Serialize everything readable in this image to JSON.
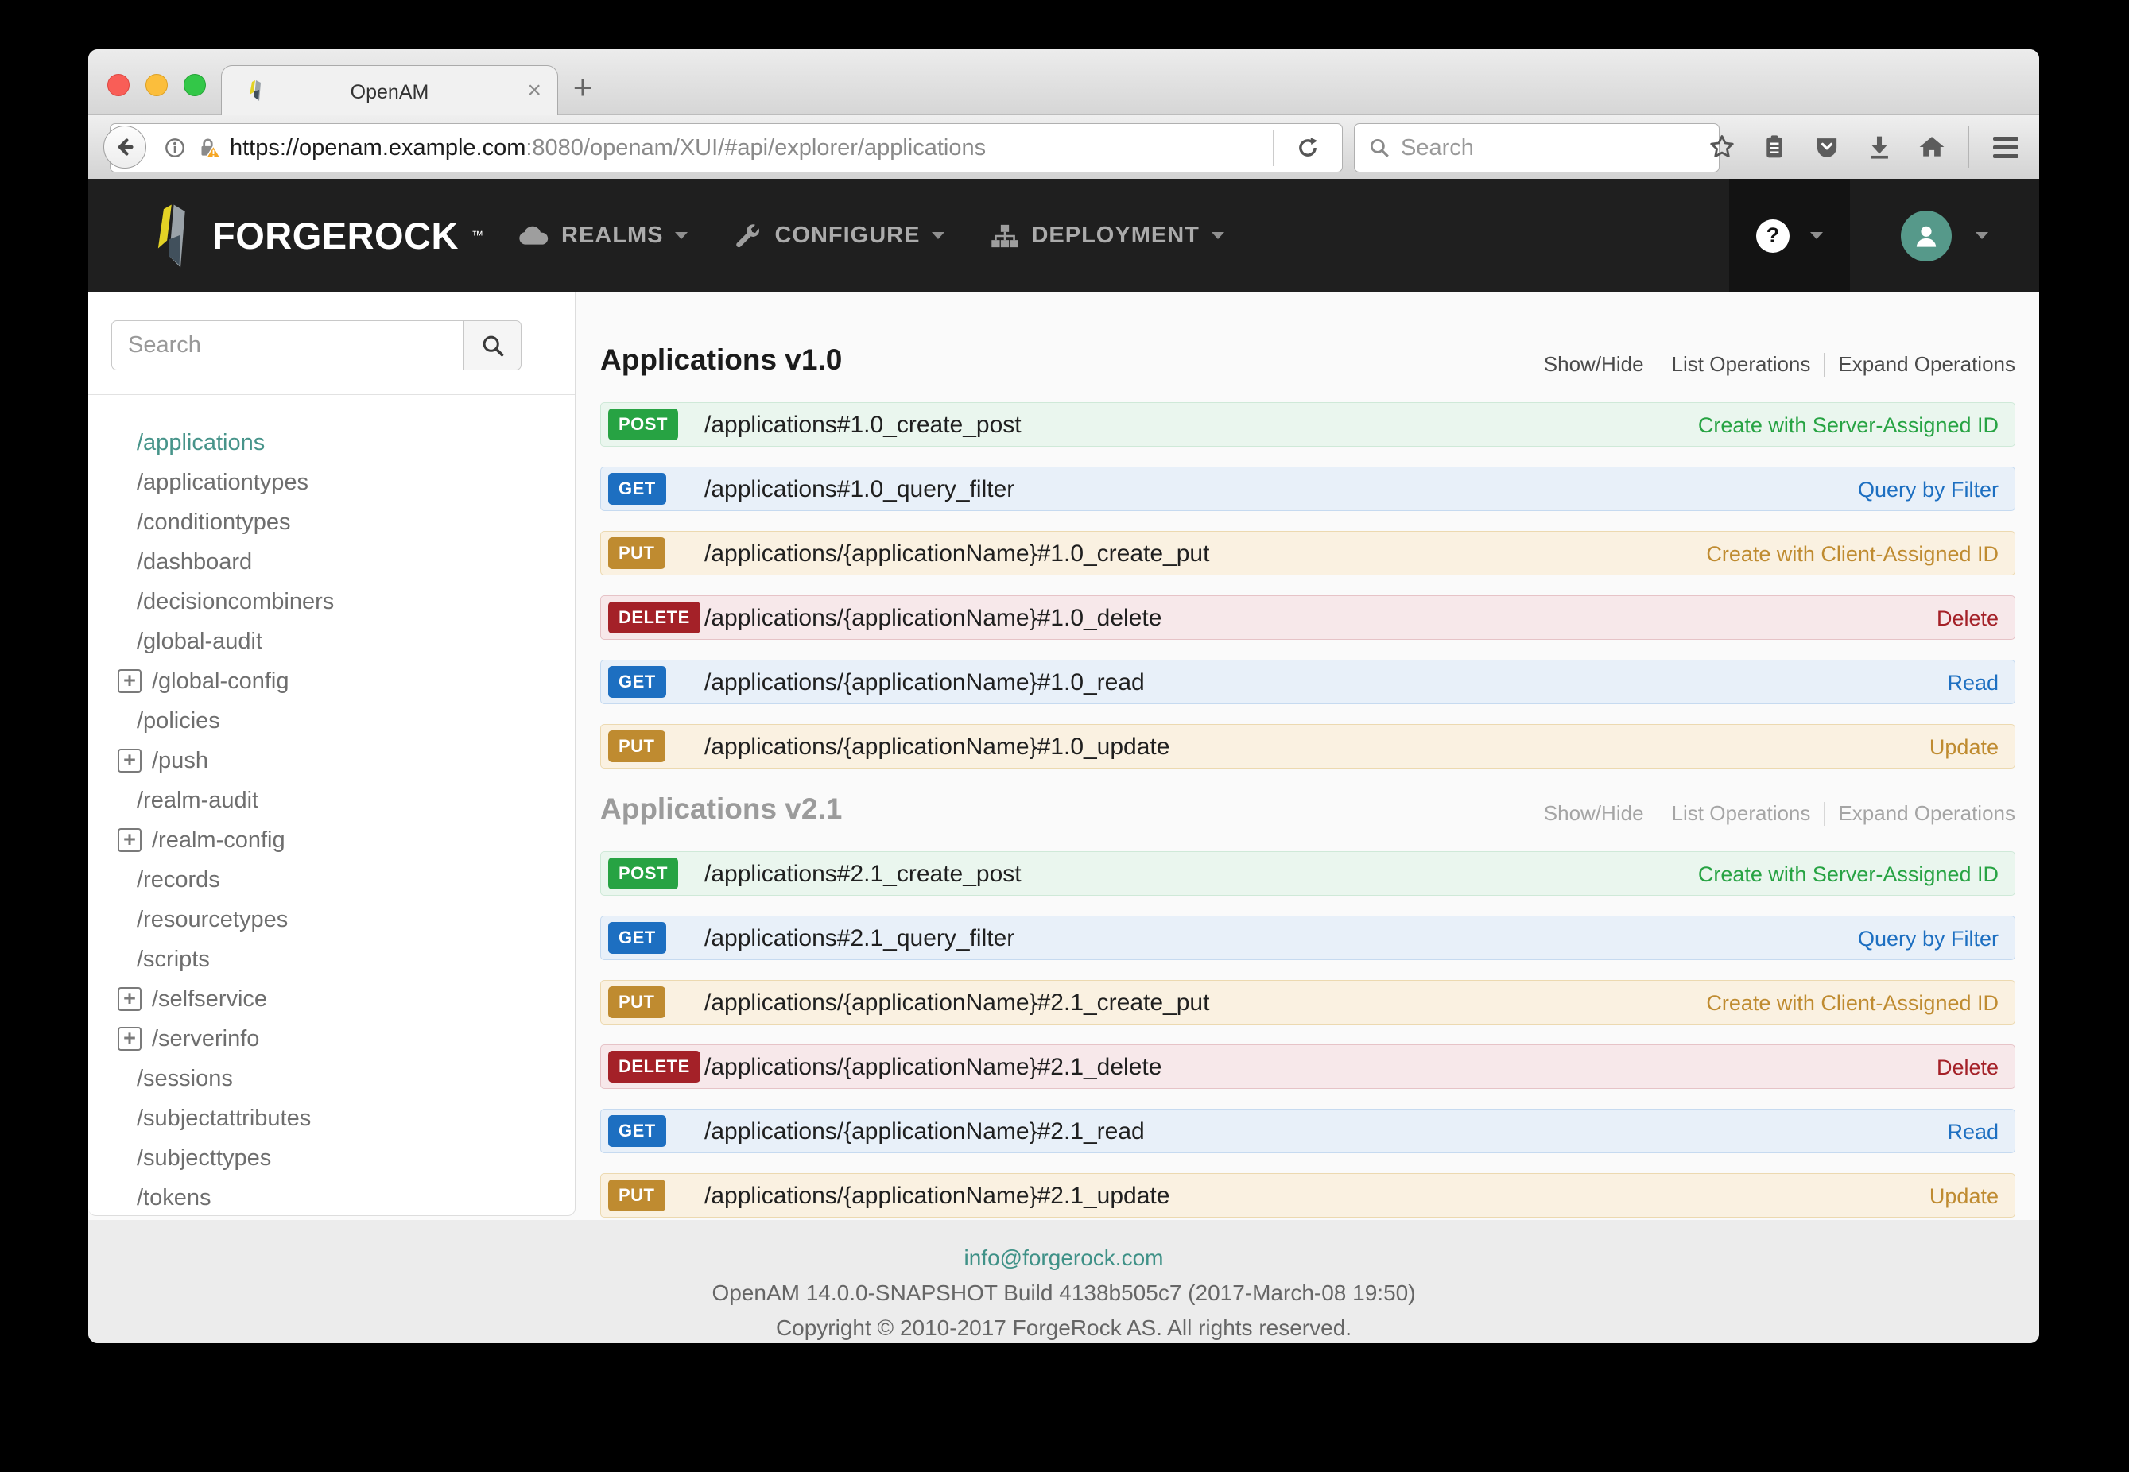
{
  "browser": {
    "tab_title": "OpenAM",
    "close_tab_label": "×",
    "new_tab_label": "+",
    "url_domain": "https://openam.example.com",
    "url_rest": ":8080/openam/XUI/#api/explorer/applications",
    "search_placeholder": "Search"
  },
  "navbar": {
    "brand": "FORGEROCK",
    "items": [
      {
        "label": "REALMS",
        "icon": "cloud-icon"
      },
      {
        "label": "CONFIGURE",
        "icon": "wrench-icon"
      },
      {
        "label": "DEPLOYMENT",
        "icon": "sitemap-icon"
      }
    ],
    "help_label": "?"
  },
  "sidebar": {
    "search_placeholder": "Search",
    "items": [
      {
        "label": "/applications",
        "active": true,
        "expandable": false
      },
      {
        "label": "/applicationtypes",
        "active": false,
        "expandable": false
      },
      {
        "label": "/conditiontypes",
        "active": false,
        "expandable": false
      },
      {
        "label": "/dashboard",
        "active": false,
        "expandable": false
      },
      {
        "label": "/decisioncombiners",
        "active": false,
        "expandable": false
      },
      {
        "label": "/global-audit",
        "active": false,
        "expandable": false
      },
      {
        "label": "/global-config",
        "active": false,
        "expandable": true
      },
      {
        "label": "/policies",
        "active": false,
        "expandable": false
      },
      {
        "label": "/push",
        "active": false,
        "expandable": true
      },
      {
        "label": "/realm-audit",
        "active": false,
        "expandable": false
      },
      {
        "label": "/realm-config",
        "active": false,
        "expandable": true
      },
      {
        "label": "/records",
        "active": false,
        "expandable": false
      },
      {
        "label": "/resourcetypes",
        "active": false,
        "expandable": false
      },
      {
        "label": "/scripts",
        "active": false,
        "expandable": false
      },
      {
        "label": "/selfservice",
        "active": false,
        "expandable": true
      },
      {
        "label": "/serverinfo",
        "active": false,
        "expandable": true
      },
      {
        "label": "/sessions",
        "active": false,
        "expandable": false
      },
      {
        "label": "/subjectattributes",
        "active": false,
        "expandable": false
      },
      {
        "label": "/subjecttypes",
        "active": false,
        "expandable": false
      },
      {
        "label": "/tokens",
        "active": false,
        "expandable": false
      }
    ]
  },
  "main": {
    "sections": [
      {
        "title": "Applications v1.0",
        "dimmed": false,
        "links": [
          "Show/Hide",
          "List Operations",
          "Expand Operations"
        ],
        "rows": [
          {
            "method": "POST",
            "path": "/applications#1.0_create_post",
            "action": "Create with Server-Assigned ID"
          },
          {
            "method": "GET",
            "path": "/applications#1.0_query_filter",
            "action": "Query by Filter"
          },
          {
            "method": "PUT",
            "path": "/applications/{applicationName}#1.0_create_put",
            "action": "Create with Client-Assigned ID"
          },
          {
            "method": "DELETE",
            "path": "/applications/{applicationName}#1.0_delete",
            "action": "Delete"
          },
          {
            "method": "GET",
            "path": "/applications/{applicationName}#1.0_read",
            "action": "Read"
          },
          {
            "method": "PUT",
            "path": "/applications/{applicationName}#1.0_update",
            "action": "Update"
          }
        ]
      },
      {
        "title": "Applications v2.1",
        "dimmed": true,
        "links": [
          "Show/Hide",
          "List Operations",
          "Expand Operations"
        ],
        "rows": [
          {
            "method": "POST",
            "path": "/applications#2.1_create_post",
            "action": "Create with Server-Assigned ID"
          },
          {
            "method": "GET",
            "path": "/applications#2.1_query_filter",
            "action": "Query by Filter"
          },
          {
            "method": "PUT",
            "path": "/applications/{applicationName}#2.1_create_put",
            "action": "Create with Client-Assigned ID"
          },
          {
            "method": "DELETE",
            "path": "/applications/{applicationName}#2.1_delete",
            "action": "Delete"
          },
          {
            "method": "GET",
            "path": "/applications/{applicationName}#2.1_read",
            "action": "Read"
          },
          {
            "method": "PUT",
            "path": "/applications/{applicationName}#2.1_update",
            "action": "Update"
          }
        ]
      }
    ]
  },
  "footer": {
    "email": "info@forgerock.com",
    "build": "OpenAM 14.0.0-SNAPSHOT Build 4138b505c7 (2017-March-08 19:50)",
    "copyright": "Copyright © 2010-2017 ForgeRock AS. All rights reserved."
  },
  "colors": {
    "accent_teal": "#47948a",
    "navbar_bg": "#1f1f1f",
    "post": "#27a343",
    "get": "#1d6fc1",
    "put": "#bf8b30",
    "delete": "#a42128"
  }
}
